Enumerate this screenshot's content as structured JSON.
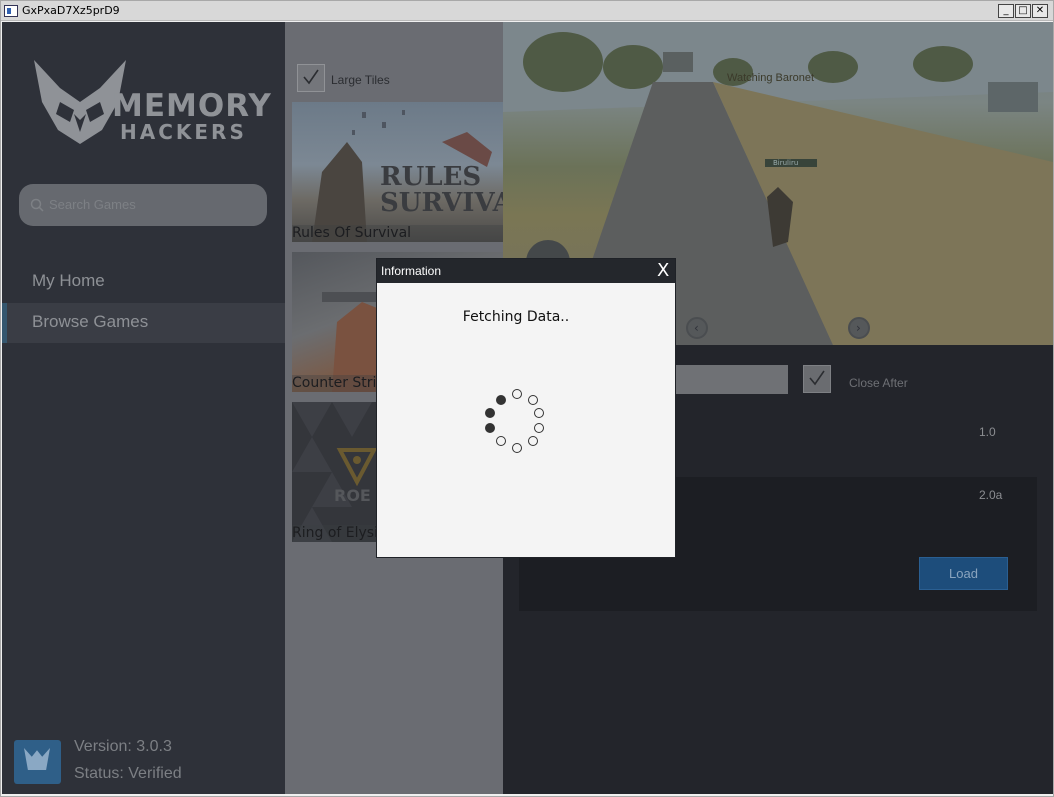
{
  "window": {
    "title": "GxPxaD7Xz5prD9",
    "minimize": "_",
    "maximize": "□",
    "close": "✕"
  },
  "sidebar": {
    "logo": {
      "line1": "MEMORY",
      "line2": "HACKERS"
    },
    "search_placeholder": "Search Games",
    "nav": [
      {
        "label": "My Home",
        "active": false
      },
      {
        "label": "Browse Games",
        "active": true
      }
    ],
    "version": "Version: 3.0.3",
    "status": "Status: Verified"
  },
  "games": {
    "large_tiles_label": "Large Tiles",
    "large_tiles_checked": true,
    "tiles": [
      {
        "name": "Rules Of Survival",
        "art_text": "RULES SURVIVAL"
      },
      {
        "name": "Counter Stri"
      },
      {
        "name": "Ring of Elysi",
        "art_text": "ROE"
      }
    ]
  },
  "detail": {
    "hud": {
      "watching": "Watching Baronet",
      "player": "Biruliru"
    },
    "close_after_label": "Close After",
    "close_after_checked": true,
    "version_1": "1.0",
    "version_2": "2.0a",
    "load_label": "Load"
  },
  "dialog": {
    "title": "Information",
    "close": "X",
    "message": "Fetching Data.."
  },
  "colors": {
    "sidebar_bg": "#2e3139",
    "accent": "#1d4d7b",
    "dialog_title_bg": "#24272c"
  }
}
